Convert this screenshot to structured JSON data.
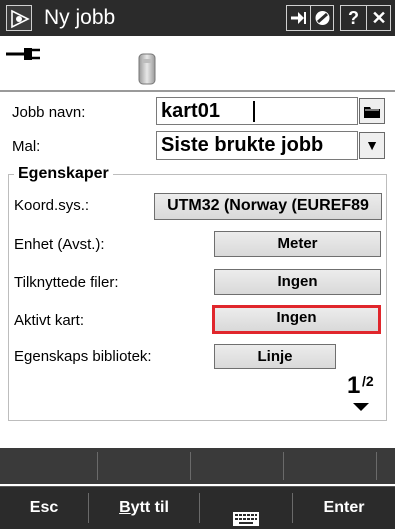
{
  "window": {
    "title": "Ny jobb",
    "icons": [
      "app-logo-icon",
      "forward-icon",
      "gps-icon",
      "help-icon",
      "close-icon"
    ],
    "help_label": "?",
    "close_label": "✕"
  },
  "status": {
    "icons": [
      "power-plug-icon",
      "device-receiver-icon"
    ]
  },
  "form": {
    "job_name_label": "Jobb navn:",
    "job_name_value": "kart01",
    "template_label": "Mal:",
    "template_value": "Siste brukte jobb",
    "dropdown_glyph": "▼"
  },
  "properties": {
    "group_title": "Egenskaper",
    "rows": [
      {
        "label": "Koord.sys.:",
        "value": "UTM32 (Norway (EUREF89"
      },
      {
        "label": "Enhet (Avst.):",
        "value": "Meter"
      },
      {
        "label": "Tilknyttede filer:",
        "value": "Ingen"
      },
      {
        "label": "Aktivt kart:",
        "value": "Ingen"
      },
      {
        "label": "Egenskaps bibliotek:",
        "value": "Linje"
      }
    ],
    "pager": {
      "current": "1",
      "total": "2"
    }
  },
  "softkeys": {
    "esc": "Esc",
    "switch_to_prefix": "B",
    "switch_to_rest": "ytt til",
    "keyboard_icon": "keyboard-icon",
    "enter": "Enter"
  },
  "colors": {
    "title_bar": "#2b2b2b",
    "active_highlight": "#e0262c",
    "button_face": "#e4e4e4"
  }
}
